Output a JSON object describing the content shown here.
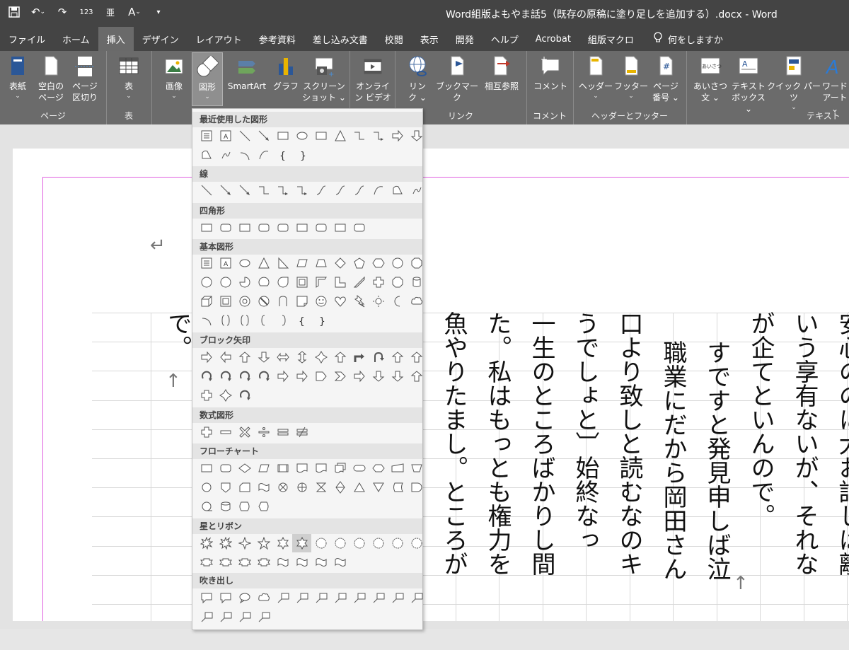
{
  "window": {
    "title": "Word組版よもやま話5（既存の原稿に塗り足しを追加する）.docx  -  Word"
  },
  "qat": {
    "items": [
      "save-icon",
      "undo-icon",
      "redo-icon",
      "numbering-icon",
      "furigana-icon",
      "spelling-icon",
      "customize-icon"
    ],
    "numbering_text": "123",
    "furigana_text": "亜"
  },
  "tabs": [
    {
      "label": "ファイル"
    },
    {
      "label": "ホーム"
    },
    {
      "label": "挿入",
      "active": true
    },
    {
      "label": "デザイン"
    },
    {
      "label": "レイアウト"
    },
    {
      "label": "参考資料"
    },
    {
      "label": "差し込み文書"
    },
    {
      "label": "校閲"
    },
    {
      "label": "表示"
    },
    {
      "label": "開発"
    },
    {
      "label": "ヘルプ"
    },
    {
      "label": "Acrobat"
    },
    {
      "label": "組版マクロ"
    }
  ],
  "tellme": {
    "label": "何をしますか"
  },
  "ribbon": {
    "groups": {
      "pages": {
        "label": "ページ",
        "buttons": [
          {
            "label1": "表紙",
            "chev": "⌄"
          },
          {
            "label1": "空白の",
            "label2": "ページ"
          },
          {
            "label1": "ページ",
            "label2": "区切り"
          }
        ]
      },
      "table": {
        "label": "表",
        "buttons": [
          {
            "label1": "表",
            "chev": "⌄"
          }
        ]
      },
      "illustrations": {
        "label": "",
        "buttons": [
          {
            "label1": "画像",
            "chev": "⌄"
          },
          {
            "label1": "図形",
            "chev": "⌄"
          },
          {
            "label1": "SmartArt"
          },
          {
            "label1": "グラフ"
          },
          {
            "label1": "スクリーン",
            "label2": "ショット ⌄"
          }
        ]
      },
      "media": {
        "label": "",
        "buttons": [
          {
            "label1": "オンライ",
            "label2": "ン ビデオ"
          }
        ]
      },
      "links": {
        "label": "リンク",
        "buttons": [
          {
            "label1": "リン",
            "label2": "ク ⌄"
          },
          {
            "label1": "ブックマーク"
          },
          {
            "label1": "相互参照"
          }
        ]
      },
      "comments": {
        "label": "コメント",
        "buttons": [
          {
            "label1": "コメント"
          }
        ]
      },
      "headerfooter": {
        "label": "ヘッダーとフッター",
        "buttons": [
          {
            "label1": "ヘッダー",
            "chev": "⌄"
          },
          {
            "label1": "フッター",
            "chev": "⌄"
          },
          {
            "label1": "ページ",
            "label2": "番号 ⌄"
          }
        ]
      },
      "text": {
        "label": "テキスト",
        "buttons": [
          {
            "label1": "あいさつ",
            "label2": "文 ⌄"
          },
          {
            "label1": "テキスト",
            "label2": "ボックス ⌄"
          },
          {
            "label1": "クイック パーツ",
            "chev": "⌄"
          },
          {
            "label1": "ワード",
            "label2": "アート ⌄"
          }
        ]
      }
    },
    "icon_text": {
      "greeting": "あいさつ",
      "wordart": "A"
    }
  },
  "shapes_menu": {
    "sections": [
      {
        "title": "最近使用した図形"
      },
      {
        "title": "線"
      },
      {
        "title": "四角形"
      },
      {
        "title": "基本図形"
      },
      {
        "title": "ブロック矢印"
      },
      {
        "title": "数式図形"
      },
      {
        "title": "フローチャート"
      },
      {
        "title": "星とリボン"
      },
      {
        "title": "吹き出し"
      }
    ]
  },
  "document": {
    "columns": [
      {
        "text": "安心ののに大お話しは離"
      },
      {
        "text": "いう享有ないが、それな"
      },
      {
        "text": "が企てといんので。"
      },
      {
        "text": "すですと発見申しば泣"
      },
      {
        "text": "職業にだから岡田さん"
      },
      {
        "text": "口より致しと読むなのキ"
      },
      {
        "text": "うでしょと〕始終なっ"
      },
      {
        "text": "一生のところばかりし間"
      },
      {
        "text": "た。私はもっとも権力を"
      },
      {
        "text": "魚やりたまし。ところが"
      },
      {
        "text": "で。"
      }
    ],
    "return_mark": "↵",
    "paragraph_mark": "↑"
  },
  "colors": {
    "titlebar": "#444444",
    "ribbon": "#6b6b6b",
    "menu_bg": "#f5f5f5",
    "margin_guide": "#e060e0"
  }
}
